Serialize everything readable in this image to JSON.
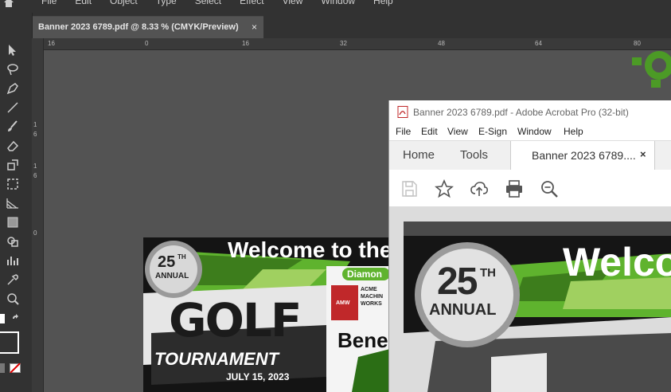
{
  "illustrator": {
    "menus": [
      "File",
      "Edit",
      "Object",
      "Type",
      "Select",
      "Effect",
      "View",
      "Window",
      "Help"
    ],
    "document_tab": "Banner 2023 6789.pdf @ 8.33 % (CMYK/Preview)",
    "close_glyph": "×",
    "ruler_h": [
      "16",
      "0",
      "16",
      "32",
      "48",
      "64",
      "80"
    ],
    "ruler_v": [
      "1",
      "6",
      "1",
      "6",
      "0"
    ]
  },
  "artwork": {
    "welcome": "Welcome to the",
    "th": "TH",
    "number": "25",
    "annual": "ANNUAL",
    "golf": "GOLF",
    "tournament": "TOURNAMENT",
    "date": "JULY 15, 2023",
    "diamond": "Diamon",
    "acme1": "ACME",
    "acme2": "MACHIN",
    "acme3": "WORKS",
    "logo_letters": "AMW",
    "bene": "Benef"
  },
  "acrobat": {
    "title": "Banner 2023 6789.pdf - Adobe Acrobat Pro (32-bit)",
    "menus": [
      "File",
      "Edit",
      "View",
      "E-Sign",
      "Window",
      "Help"
    ],
    "tabs": {
      "home": "Home",
      "tools": "Tools",
      "document": "Banner 2023 6789....",
      "close": "×"
    },
    "tools": [
      "save-icon",
      "bookmark-star-icon",
      "upload-cloud-icon",
      "print-icon",
      "zoom-search-icon"
    ],
    "page": {
      "welcome": "Welco",
      "number": "25",
      "th": "TH",
      "annual": "ANNUAL"
    }
  },
  "colors": {
    "green": "#5fb32e",
    "dark_ui": "#323232",
    "canvas": "#535353"
  }
}
